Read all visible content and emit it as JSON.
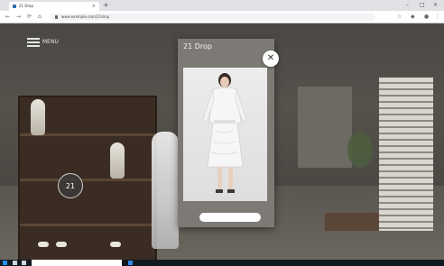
{
  "browser": {
    "tab_title": "21 Drop",
    "url": "www.example.com/21drop",
    "nav": {
      "back": "←",
      "forward": "→",
      "reload": "⟳",
      "home": "⌂"
    },
    "window_controls": {
      "minimize": "–",
      "maximize": "□",
      "close": "×"
    },
    "new_tab": "+",
    "tab_close": "×"
  },
  "site": {
    "menu_label": "MENU"
  },
  "hotspot": {
    "label": "21"
  },
  "popup": {
    "title": "21 Drop",
    "subtitle_line1": "",
    "subtitle_line2": "",
    "cta_label": "",
    "close": "✕"
  },
  "taskbar": {
    "search_placeholder": ""
  },
  "colors": {
    "popup_bg": "#7d7a76",
    "scene_wall": "#4a4844",
    "taskbar": "#101820"
  }
}
